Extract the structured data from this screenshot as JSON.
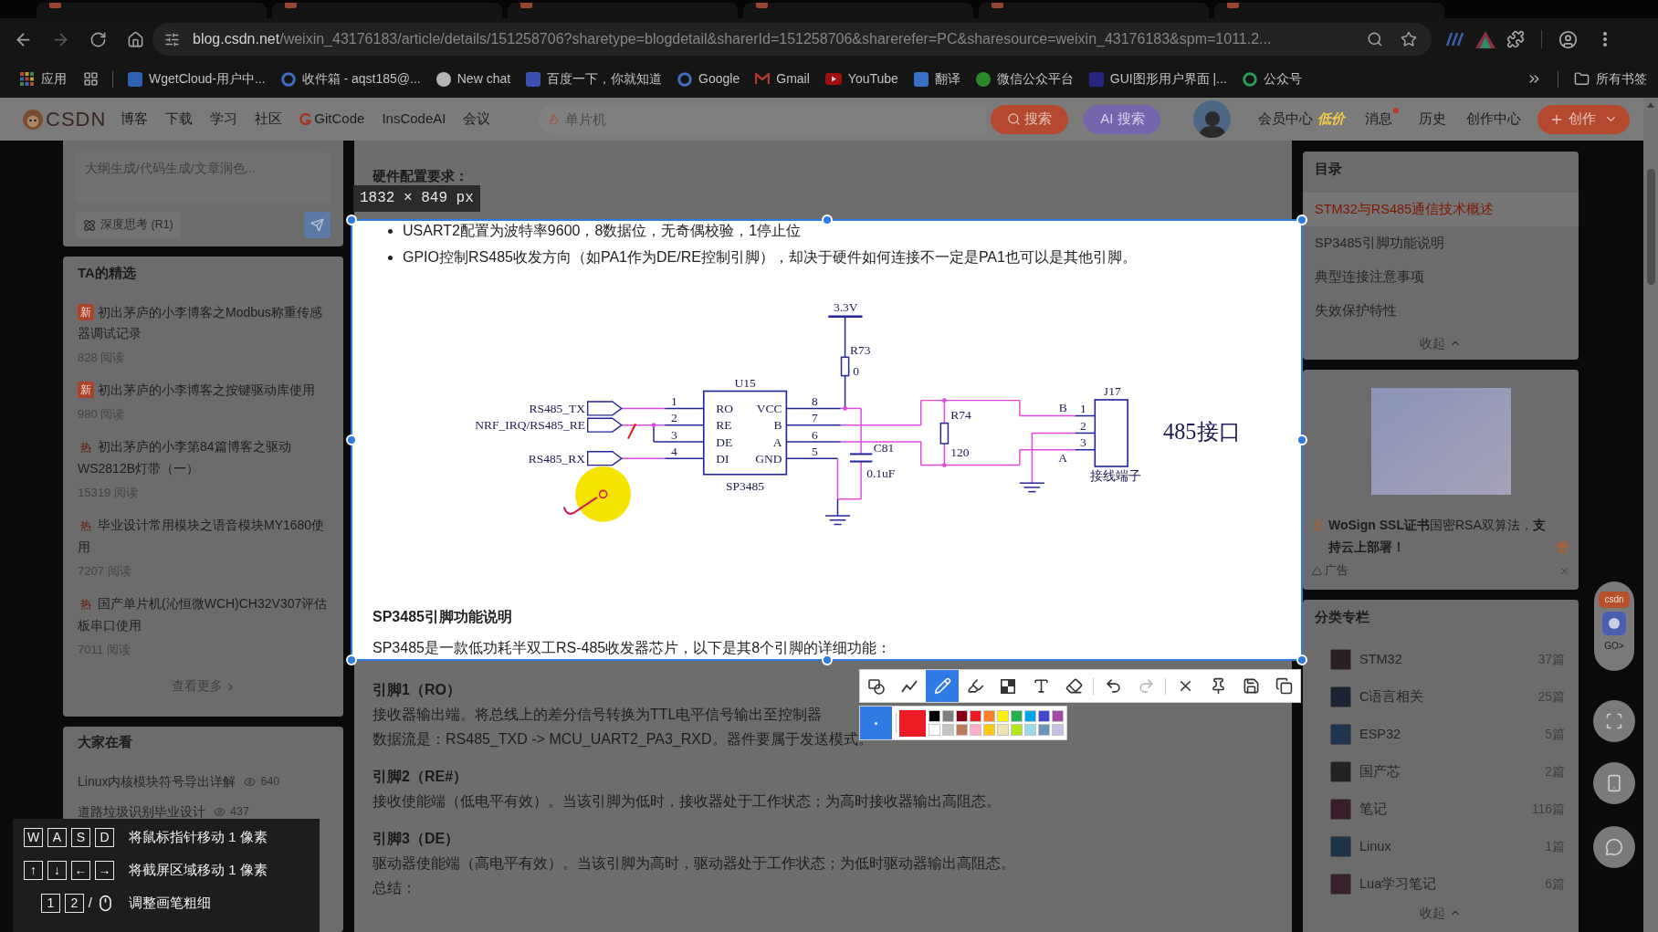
{
  "browser": {
    "forward_disabled": true,
    "address": {
      "host": "blog.csdn.net",
      "path": "/weixin_43176183/article/details/151258706?sharetype=blogdetail&sharerId=151258706&sharerefer=PC&sharesource=weixin_43176183&spm=1011.2..."
    },
    "bookmarks": [
      {
        "label": "应用"
      },
      {
        "label": "WgetCloud-用户中..."
      },
      {
        "label": "收件箱 - aqst185@..."
      },
      {
        "label": "New chat"
      },
      {
        "label": "百度一下，你就知道"
      },
      {
        "label": "Google"
      },
      {
        "label": "Gmail"
      },
      {
        "label": "YouTube"
      },
      {
        "label": "翻译"
      },
      {
        "label": "微信公众平台"
      },
      {
        "label": "GUI图形用户界面 |..."
      },
      {
        "label": "公众号"
      }
    ],
    "all_bookmarks": "所有书签"
  },
  "csdn_nav": {
    "logo": "CSDN",
    "links": [
      {
        "label": "博客",
        "icon": false
      },
      {
        "label": "下载",
        "icon": false
      },
      {
        "label": "学习",
        "icon": false
      },
      {
        "label": "社区",
        "icon": false
      },
      {
        "label": "GitCode",
        "icon": true
      },
      {
        "label": "InsCodeAI",
        "icon": false
      },
      {
        "label": "会议",
        "icon": false
      }
    ],
    "search": {
      "placeholder": "单片机"
    },
    "search_button": "搜索",
    "ai_search_button": "AI 搜索",
    "menu": [
      {
        "label": "会员中心",
        "badge": "低价",
        "unread": false
      },
      {
        "label": "消息",
        "unread": true
      },
      {
        "label": "历史",
        "unread": false
      },
      {
        "label": "创作中心",
        "unread": false
      }
    ],
    "create_button": "创作"
  },
  "ai_assistant": {
    "placeholder": "大纲生成/代码生成/文章润色...",
    "deep_think": "深度思考 (R1)"
  },
  "featured": {
    "title": "TA的精选",
    "items": [
      {
        "kind": "new",
        "badge": "新",
        "title": "初出茅庐的小李博客之Modbus称重传感器调试记录",
        "reads": "828 阅读"
      },
      {
        "kind": "new",
        "badge": "新",
        "title": "初出茅庐的小李博客之按键驱动库使用",
        "reads": "980 阅读"
      },
      {
        "kind": "hot",
        "badge": "热",
        "title": "初出茅庐的小李第84篇博客之驱动WS2812B灯带（一）",
        "reads": "15319 阅读"
      },
      {
        "kind": "hot",
        "badge": "热",
        "title": "毕业设计常用模块之语音模块MY1680使用",
        "reads": "7207 阅读"
      },
      {
        "kind": "hot",
        "badge": "热",
        "title": "国产单片机(沁恒微WCH)CH32V307评估板串口使用",
        "reads": "7011 阅读"
      }
    ],
    "more": "查看更多"
  },
  "trending": {
    "title": "大家在看",
    "items": [
      {
        "title": "Linux内核模块符号导出详解",
        "views": "640"
      },
      {
        "title": "道路垃圾识别毕业设计",
        "views": "437"
      }
    ]
  },
  "article": {
    "heading": "硬件配置要求：",
    "bullets": [
      "USART2配置为波特率9600，8数据位，无奇偶校验，1停止位",
      "GPIO控制RS485收发方向（如PA1作为DE/RE控制引脚），却决于硬件如何连接不一定是PA1也可以是其他引脚。"
    ],
    "schematic": {
      "supply": "3.3V",
      "r73": {
        "ref": "R73",
        "value": "0"
      },
      "chip": {
        "ref": "U15",
        "part": "SP3485",
        "left_pins": [
          {
            "num": "1",
            "name": "RO"
          },
          {
            "num": "2",
            "name": "RE"
          },
          {
            "num": "3",
            "name": "DE"
          },
          {
            "num": "4",
            "name": "DI"
          }
        ],
        "right_pins": [
          {
            "num": "8",
            "name": "VCC"
          },
          {
            "num": "7",
            "name": "B"
          },
          {
            "num": "6",
            "name": "A"
          },
          {
            "num": "5",
            "name": "GND"
          }
        ]
      },
      "ports": [
        "RS485_TX",
        "NRF_IRQ/RS485_RE",
        "RS485_RX"
      ],
      "c81": {
        "ref": "C81",
        "value": "0.1uF"
      },
      "r74": {
        "ref": "R74",
        "value": "120"
      },
      "bus_b": "B",
      "bus_a": "A",
      "connector": {
        "ref": "J17",
        "pins": [
          "1",
          "2",
          "3"
        ],
        "name": "接线端子"
      },
      "caption": "485接口"
    },
    "section_title": "SP3485引脚功能说明",
    "intro": "SP3485是一款低功耗半双工RS-485收发器芯片，以下是其8个引脚的详细功能：",
    "pins": [
      {
        "title": "引脚1（RO）",
        "lines": [
          "接收器输出端。将总线上的差分信号转换为TTL电平信号输出至控制器",
          "数据流是：RS485_TXD -> MCU_UART2_PA3_RXD。器件要属于发送模式。"
        ]
      },
      {
        "title": "引脚2（RE#）",
        "lines": [
          "接收使能端（低电平有效）。当该引脚为低时，接收器处于工作状态；为高时接收器输出高阻态。"
        ]
      },
      {
        "title": "引脚3（DE）",
        "lines": [
          "驱动器使能端（高电平有效）。当该引脚为高时，驱动器处于工作状态；为低时驱动器输出高阻态。"
        ]
      }
    ],
    "summary": "总结："
  },
  "screenshot_tool": {
    "size_label": "1832 × 849 px",
    "tools": [
      {
        "kind": "shape",
        "selected": false
      },
      {
        "kind": "line",
        "selected": false
      },
      {
        "kind": "pen",
        "selected": true
      },
      {
        "kind": "marker",
        "selected": false
      },
      {
        "kind": "mosaic",
        "selected": false
      },
      {
        "kind": "text",
        "selected": false
      },
      {
        "kind": "eraser",
        "selected": false
      }
    ],
    "history": [
      {
        "kind": "undo",
        "disabled": false
      },
      {
        "kind": "redo",
        "disabled": true
      }
    ],
    "actions": [
      {
        "kind": "close"
      },
      {
        "kind": "pin"
      },
      {
        "kind": "save"
      },
      {
        "kind": "copy"
      }
    ],
    "current": {
      "color": "#ed1c24"
    },
    "palette": [
      {
        "color": "#000000"
      },
      {
        "color": "#7f7f7f"
      },
      {
        "color": "#880015"
      },
      {
        "color": "#ed1c24"
      },
      {
        "color": "#ff7f27"
      },
      {
        "color": "#fff200"
      },
      {
        "color": "#22b14c"
      },
      {
        "color": "#00a2e8"
      },
      {
        "color": "#3f48cc"
      },
      {
        "color": "#a349a4"
      },
      {
        "color": "#ffffff"
      },
      {
        "color": "#c3c3c3"
      },
      {
        "color": "#b97a57"
      },
      {
        "color": "#ffaec9"
      },
      {
        "color": "#ffc90e"
      },
      {
        "color": "#efe4b0"
      },
      {
        "color": "#b5e61d"
      },
      {
        "color": "#99d9ea"
      },
      {
        "color": "#7092be"
      },
      {
        "color": "#c8bfe7"
      }
    ],
    "key_hints": [
      {
        "keys": [
          "W",
          "A",
          "S",
          "D"
        ],
        "text": "将鼠标指针移动 1 像素"
      },
      {
        "keys": [
          "↑",
          "↓",
          "←",
          "→"
        ],
        "text": "将截屏区域移动 1 像素"
      },
      {
        "keys": [
          "1",
          "2"
        ],
        "separator": "/",
        "text": "调整画笔粗细"
      }
    ]
  },
  "toc": {
    "title": "目录",
    "items": [
      {
        "label": "STM32与RS485通信技术概述",
        "selected": true
      },
      {
        "label": "SP3485引脚功能说明",
        "selected": false
      },
      {
        "label": "典型连接注意事项",
        "selected": false
      },
      {
        "label": "失效保护特性",
        "selected": false
      }
    ],
    "collapse": "收起"
  },
  "ad": {
    "text": "**WoSign SSL证书**国密RSA双算法，**支持云上部署！**",
    "label": "广告"
  },
  "columns": {
    "title": "分类专栏",
    "items": [
      {
        "name": "STM32",
        "count": "37篇"
      },
      {
        "name": "C语言相关",
        "count": "25篇"
      },
      {
        "name": "ESP32",
        "count": "5篇"
      },
      {
        "name": "国产芯",
        "count": "2篇"
      },
      {
        "name": "笔记",
        "count": "116篇"
      },
      {
        "name": "Linux",
        "count": "1篇"
      },
      {
        "name": "Lua学习笔记",
        "count": "6篇"
      }
    ],
    "collapse": "收起"
  },
  "plugin": {
    "logo": "csdn",
    "go": "GO>"
  }
}
